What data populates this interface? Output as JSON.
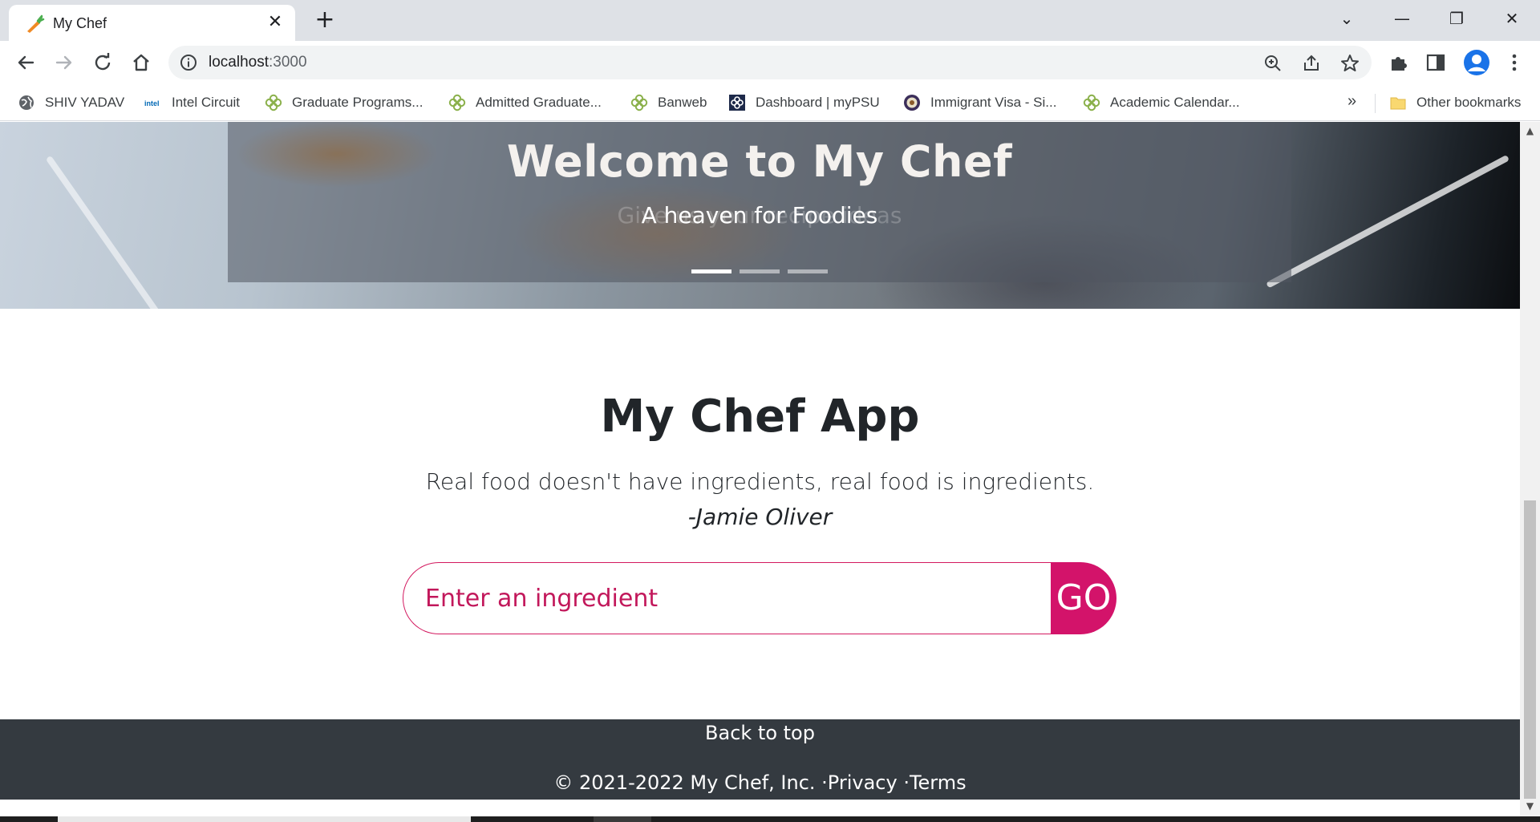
{
  "browser": {
    "tab": {
      "title": "My Chef",
      "close": "✕"
    },
    "new_tab": "+",
    "window": {
      "minimize": "—",
      "restore": "❐",
      "close": "✕",
      "tab_search": "⌄"
    },
    "address": {
      "host": "localhost",
      "port": ":3000"
    },
    "bookmarks": [
      {
        "label": "SHIV YADAV",
        "icon": "globe-icon"
      },
      {
        "label": "Intel Circuit",
        "icon": "intel-icon"
      },
      {
        "label": "Graduate Programs...",
        "icon": "clover-icon"
      },
      {
        "label": "Admitted Graduate...",
        "icon": "clover-icon"
      },
      {
        "label": "Banweb",
        "icon": "clover-icon"
      },
      {
        "label": "Dashboard | myPSU",
        "icon": "mypsu-icon"
      },
      {
        "label": "Immigrant Visa - Si...",
        "icon": "seal-icon"
      },
      {
        "label": "Academic Calendar...",
        "icon": "clover-icon"
      }
    ],
    "bookmarks_more": "»",
    "other_bookmarks": "Other bookmarks"
  },
  "hero": {
    "title": "Welcome to My Chef",
    "subtitle": "A heaven for Foodies",
    "ghost_caption": "Give us your recipe ideas",
    "indicators": 3,
    "active_indicator": 0
  },
  "main": {
    "title": "My Chef App",
    "quote": "Real food doesn't have ingredients, real food is ingredients.",
    "quote_author": "-Jamie Oliver",
    "search": {
      "placeholder": "Enter an ingredient",
      "value": "",
      "button": "GO"
    }
  },
  "footer": {
    "back_to_top": "Back to top",
    "copyright": "© 2021-2022 My Chef, Inc. ",
    "privacy": "·Privacy ",
    "terms": "·Terms"
  },
  "colors": {
    "accent": "#d3136a",
    "footer_bg": "#343a40"
  }
}
